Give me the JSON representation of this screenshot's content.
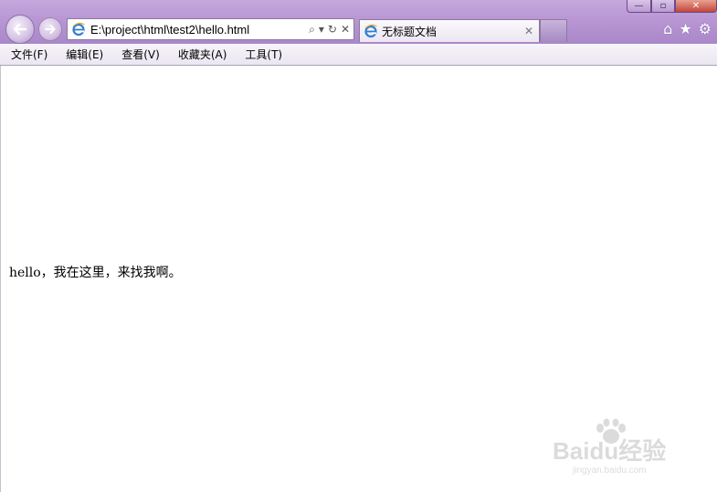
{
  "window": {
    "controls": {
      "minimize": "—",
      "maximize": "▫",
      "close": "✕"
    }
  },
  "navigation": {
    "back_icon": "back-arrow-icon",
    "forward_icon": "forward-arrow-icon"
  },
  "address_bar": {
    "url": "E:\\project\\html\\test2\\hello.html",
    "search_icon": "⌕",
    "dropdown_icon": "▾",
    "refresh_icon": "↻",
    "stop_icon": "✕"
  },
  "tab": {
    "title": "无标题文档",
    "close_icon": "✕"
  },
  "toolbar_icons": {
    "home": "⌂",
    "favorites": "★",
    "tools": "⚙"
  },
  "menu": {
    "items": [
      {
        "label": "文件(F)"
      },
      {
        "label": "编辑(E)"
      },
      {
        "label": "查看(V)"
      },
      {
        "label": "收藏夹(A)"
      },
      {
        "label": "工具(T)"
      }
    ]
  },
  "page": {
    "text": "hello，我在这里，来找我啊。"
  },
  "watermark": {
    "brand": "Baidu经验",
    "url": "jingyan.baidu.com"
  },
  "colors": {
    "frame": "#b996d4",
    "menubar": "#f0ecf5",
    "content_bg": "#ffffff"
  }
}
